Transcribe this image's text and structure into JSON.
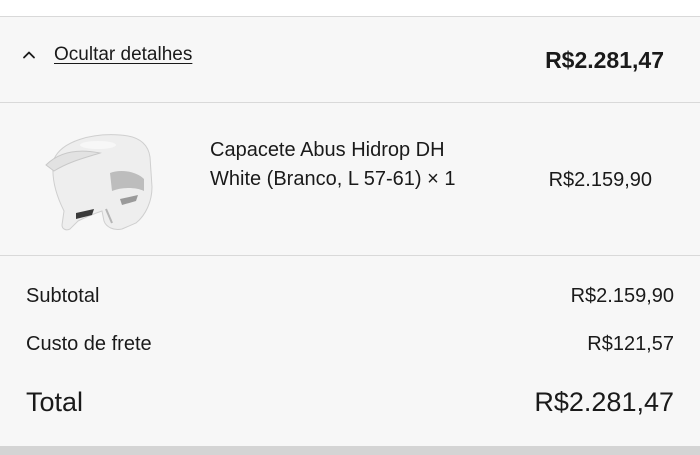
{
  "summary": {
    "toggle_label": "Ocultar detalhes",
    "toggle_icon": "chevron-up-icon",
    "total": "R$2.281,47"
  },
  "line_items": [
    {
      "name": "Capacete Abus Hidrop DH White (Branco, L 57-61) × 1",
      "price": "R$2.159,90",
      "image": "helmet-image"
    }
  ],
  "totals": {
    "subtotal_label": "Subtotal",
    "subtotal_value": "R$2.159,90",
    "shipping_label": "Custo de frete",
    "shipping_value": "R$121,57",
    "total_label": "Total",
    "total_value": "R$2.281,47"
  },
  "colors": {
    "panel_bg": "#f7f7f7",
    "divider": "#d9d9d9",
    "text": "#1a1a1a"
  }
}
